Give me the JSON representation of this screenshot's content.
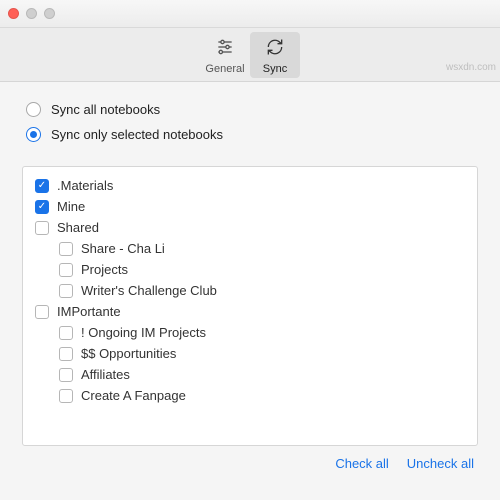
{
  "toolbar": {
    "general_label": "General",
    "sync_label": "Sync"
  },
  "options": {
    "sync_all_label": "Sync all notebooks",
    "sync_selected_label": "Sync only selected notebooks",
    "selected": "selected"
  },
  "notebooks": [
    {
      "label": ".Materials",
      "checked": true,
      "depth": 0
    },
    {
      "label": "Mine",
      "checked": true,
      "depth": 0
    },
    {
      "label": "Shared",
      "checked": false,
      "depth": 0
    },
    {
      "label": "Share - Cha Li",
      "checked": false,
      "depth": 1
    },
    {
      "label": "Projects",
      "checked": false,
      "depth": 1
    },
    {
      "label": "Writer's Challenge Club",
      "checked": false,
      "depth": 1
    },
    {
      "label": "IMPortante",
      "checked": false,
      "depth": 0
    },
    {
      "label": "! Ongoing IM Projects",
      "checked": false,
      "depth": 1
    },
    {
      "label": "$$ Opportunities",
      "checked": false,
      "depth": 1
    },
    {
      "label": "Affiliates",
      "checked": false,
      "depth": 1
    },
    {
      "label": "Create A Fanpage",
      "checked": false,
      "depth": 1
    }
  ],
  "actions": {
    "check_all": "Check all",
    "uncheck_all": "Uncheck all"
  },
  "watermark": "wsxdn.com"
}
